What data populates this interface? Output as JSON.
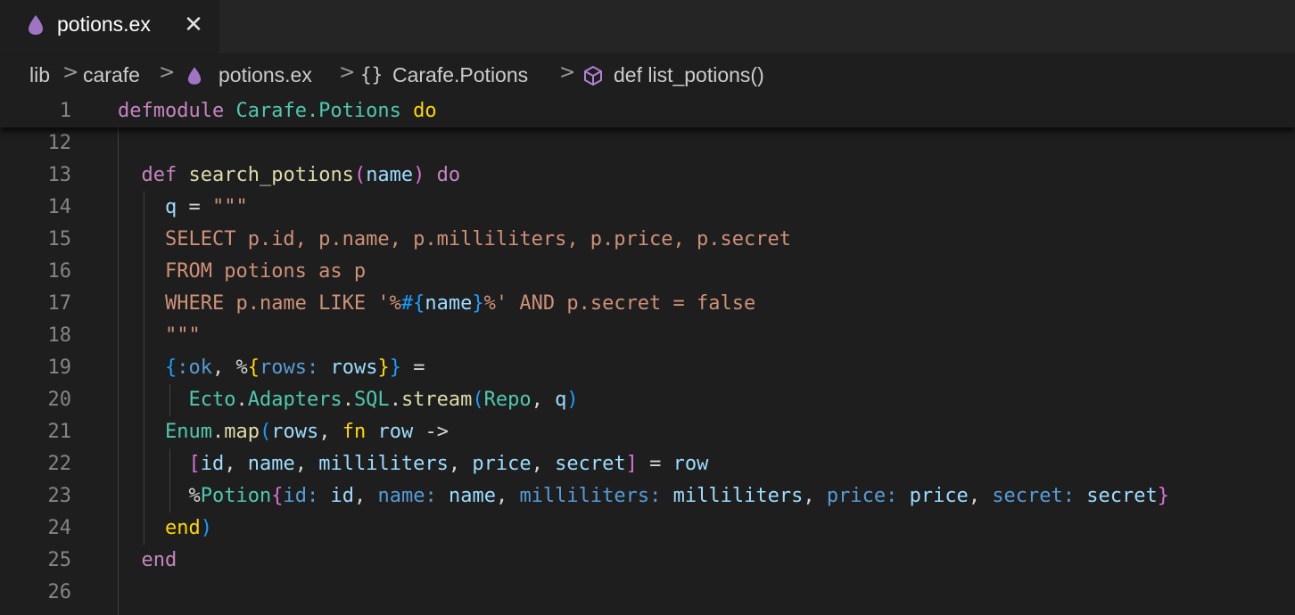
{
  "tab": {
    "filename": "potions.ex",
    "close_glyph": "✕",
    "icon": "elixir-drop-icon",
    "icon_color": "#a074c4"
  },
  "breadcrumb": {
    "items": [
      "lib",
      "carafe",
      "potions.ex",
      "Carafe.Potions",
      "def list_potions()"
    ],
    "module_icon": "{}",
    "separator": ">"
  },
  "sticky_line": {
    "number": "1",
    "tokens": [
      {
        "t": "defmodule",
        "c": "kw"
      },
      {
        "t": " ",
        "c": "op"
      },
      {
        "t": "Carafe.Potions",
        "c": "mod"
      },
      {
        "t": " ",
        "c": "op"
      },
      {
        "t": "do",
        "c": "b1"
      }
    ]
  },
  "lines": [
    {
      "number": "12",
      "tokens": []
    },
    {
      "number": "13",
      "tokens": [
        {
          "t": "  "
        },
        {
          "t": "def",
          "c": "kw"
        },
        {
          "t": " "
        },
        {
          "t": "search_potions",
          "c": "fn"
        },
        {
          "t": "(",
          "c": "b2"
        },
        {
          "t": "name",
          "c": "var"
        },
        {
          "t": ")",
          "c": "b2"
        },
        {
          "t": " "
        },
        {
          "t": "do",
          "c": "kw"
        }
      ]
    },
    {
      "number": "14",
      "tokens": [
        {
          "t": "    "
        },
        {
          "t": "q",
          "c": "var"
        },
        {
          "t": " = "
        },
        {
          "t": "\"\"\"",
          "c": "str"
        }
      ]
    },
    {
      "number": "15",
      "tokens": [
        {
          "t": "    "
        },
        {
          "t": "SELECT p.id, p.name, p.milliliters, p.price, p.secret",
          "c": "str"
        }
      ]
    },
    {
      "number": "16",
      "tokens": [
        {
          "t": "    "
        },
        {
          "t": "FROM potions as p",
          "c": "str"
        }
      ]
    },
    {
      "number": "17",
      "tokens": [
        {
          "t": "    "
        },
        {
          "t": "WHERE p.name LIKE '%",
          "c": "str"
        },
        {
          "t": "#{",
          "c": "b3"
        },
        {
          "t": "name",
          "c": "var"
        },
        {
          "t": "}",
          "c": "b3"
        },
        {
          "t": "%' AND p.secret = false",
          "c": "str"
        }
      ]
    },
    {
      "number": "18",
      "tokens": [
        {
          "t": "    "
        },
        {
          "t": "\"\"\"",
          "c": "str"
        }
      ]
    },
    {
      "number": "19",
      "tokens": [
        {
          "t": "    "
        },
        {
          "t": "{",
          "c": "b3"
        },
        {
          "t": ":ok",
          "c": "atom"
        },
        {
          "t": ", %"
        },
        {
          "t": "{",
          "c": "b1"
        },
        {
          "t": "rows:",
          "c": "key"
        },
        {
          "t": " "
        },
        {
          "t": "rows",
          "c": "var"
        },
        {
          "t": "}",
          "c": "b1"
        },
        {
          "t": "}",
          "c": "b3"
        },
        {
          "t": " ="
        }
      ]
    },
    {
      "number": "20",
      "tokens": [
        {
          "t": "      "
        },
        {
          "t": "Ecto",
          "c": "mod"
        },
        {
          "t": "."
        },
        {
          "t": "Adapters",
          "c": "mod"
        },
        {
          "t": "."
        },
        {
          "t": "SQL",
          "c": "mod"
        },
        {
          "t": "."
        },
        {
          "t": "stream",
          "c": "fn"
        },
        {
          "t": "(",
          "c": "b3"
        },
        {
          "t": "Repo",
          "c": "mod"
        },
        {
          "t": ", "
        },
        {
          "t": "q",
          "c": "var"
        },
        {
          "t": ")",
          "c": "b3"
        }
      ]
    },
    {
      "number": "21",
      "tokens": [
        {
          "t": "    "
        },
        {
          "t": "Enum",
          "c": "mod"
        },
        {
          "t": "."
        },
        {
          "t": "map",
          "c": "fn"
        },
        {
          "t": "(",
          "c": "b3"
        },
        {
          "t": "rows",
          "c": "var"
        },
        {
          "t": ", "
        },
        {
          "t": "fn",
          "c": "b1"
        },
        {
          "t": " "
        },
        {
          "t": "row",
          "c": "var"
        },
        {
          "t": " ->"
        }
      ]
    },
    {
      "number": "22",
      "tokens": [
        {
          "t": "      "
        },
        {
          "t": "[",
          "c": "b2"
        },
        {
          "t": "id",
          "c": "var"
        },
        {
          "t": ", "
        },
        {
          "t": "name",
          "c": "var"
        },
        {
          "t": ", "
        },
        {
          "t": "milliliters",
          "c": "var"
        },
        {
          "t": ", "
        },
        {
          "t": "price",
          "c": "var"
        },
        {
          "t": ", "
        },
        {
          "t": "secret",
          "c": "var"
        },
        {
          "t": "]",
          "c": "b2"
        },
        {
          "t": " = "
        },
        {
          "t": "row",
          "c": "var"
        }
      ]
    },
    {
      "number": "23",
      "tokens": [
        {
          "t": "      "
        },
        {
          "t": "%"
        },
        {
          "t": "Potion",
          "c": "mod"
        },
        {
          "t": "{",
          "c": "b2"
        },
        {
          "t": "id:",
          "c": "key"
        },
        {
          "t": " "
        },
        {
          "t": "id",
          "c": "var"
        },
        {
          "t": ", "
        },
        {
          "t": "name:",
          "c": "key"
        },
        {
          "t": " "
        },
        {
          "t": "name",
          "c": "var"
        },
        {
          "t": ", "
        },
        {
          "t": "milliliters:",
          "c": "key"
        },
        {
          "t": " "
        },
        {
          "t": "milliliters",
          "c": "var"
        },
        {
          "t": ", "
        },
        {
          "t": "price:",
          "c": "key"
        },
        {
          "t": " "
        },
        {
          "t": "price",
          "c": "var"
        },
        {
          "t": ", "
        },
        {
          "t": "secret:",
          "c": "key"
        },
        {
          "t": " "
        },
        {
          "t": "secret",
          "c": "var"
        },
        {
          "t": "}",
          "c": "b2"
        }
      ]
    },
    {
      "number": "24",
      "tokens": [
        {
          "t": "    "
        },
        {
          "t": "end",
          "c": "b1"
        },
        {
          "t": ")",
          "c": "b3"
        }
      ]
    },
    {
      "number": "25",
      "tokens": [
        {
          "t": "  "
        },
        {
          "t": "end",
          "c": "kw"
        }
      ]
    },
    {
      "number": "26",
      "tokens": []
    }
  ]
}
